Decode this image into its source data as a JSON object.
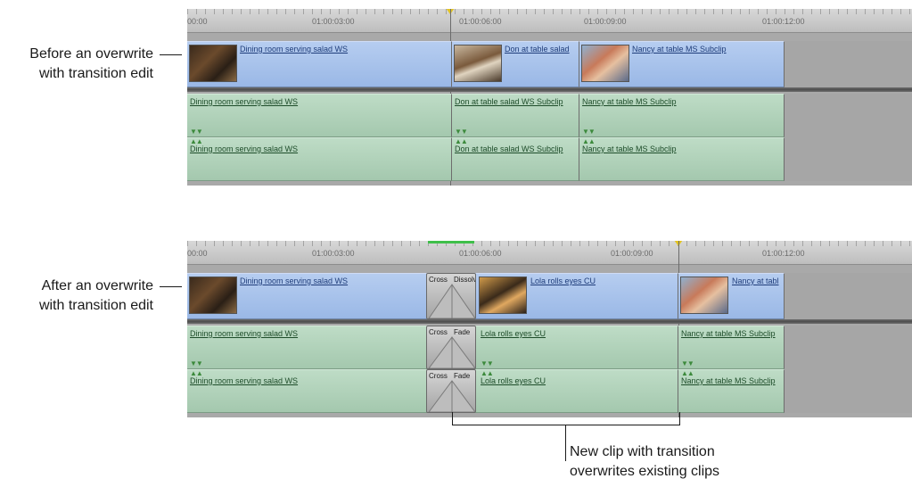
{
  "top": {
    "callout_line1": "Before an overwrite",
    "callout_line2": "with transition edit",
    "ruler": [
      "00:00",
      "01:00:03:00",
      "01:00:06:00",
      "01:00:09:00",
      "01:00:12:00"
    ],
    "video": [
      "Dining room serving salad WS",
      "Don at table salad",
      "Nancy at table MS Subclip"
    ],
    "audio1": [
      "Dining room serving salad WS",
      "Don at table salad WS Subclip",
      "Nancy at table MS Subclip"
    ],
    "audio2": [
      "Dining room serving salad WS",
      "Don at table salad WS Subclip",
      "Nancy at table MS Subclip"
    ]
  },
  "bottom": {
    "callout_line1": "After an overwrite",
    "callout_line2": "with transition edit",
    "ruler": [
      "00:00",
      "01:00:03:00",
      "01:00:06:00",
      "01:00:09:00",
      "01:00:12:00"
    ],
    "video": [
      "Dining room serving salad WS",
      "Lola rolls eyes CU",
      "Nancy at tabl"
    ],
    "video_transition": [
      "Cross",
      "Dissolve"
    ],
    "audio1": [
      "Dining room serving salad WS",
      "Lola rolls eyes CU",
      "Nancy at table MS Subclip"
    ],
    "audio2": [
      "Dining room serving salad WS",
      "Lola rolls eyes CU",
      "Nancy at table MS Subclip"
    ],
    "audio_transition": [
      "Cross",
      "Fade"
    ]
  },
  "bracket": {
    "line1": "New clip with transition",
    "line2": "overwrites existing clips"
  },
  "colors": {
    "video_clip": "#9ab8e6",
    "audio_clip": "#a4c8ae",
    "playhead": "#e2c322",
    "render_bar": "#3fbf4a"
  },
  "icons": {
    "playhead": "playhead-marker-icon",
    "link": "audio-link-marker-icon",
    "transition": "transition-icon"
  }
}
